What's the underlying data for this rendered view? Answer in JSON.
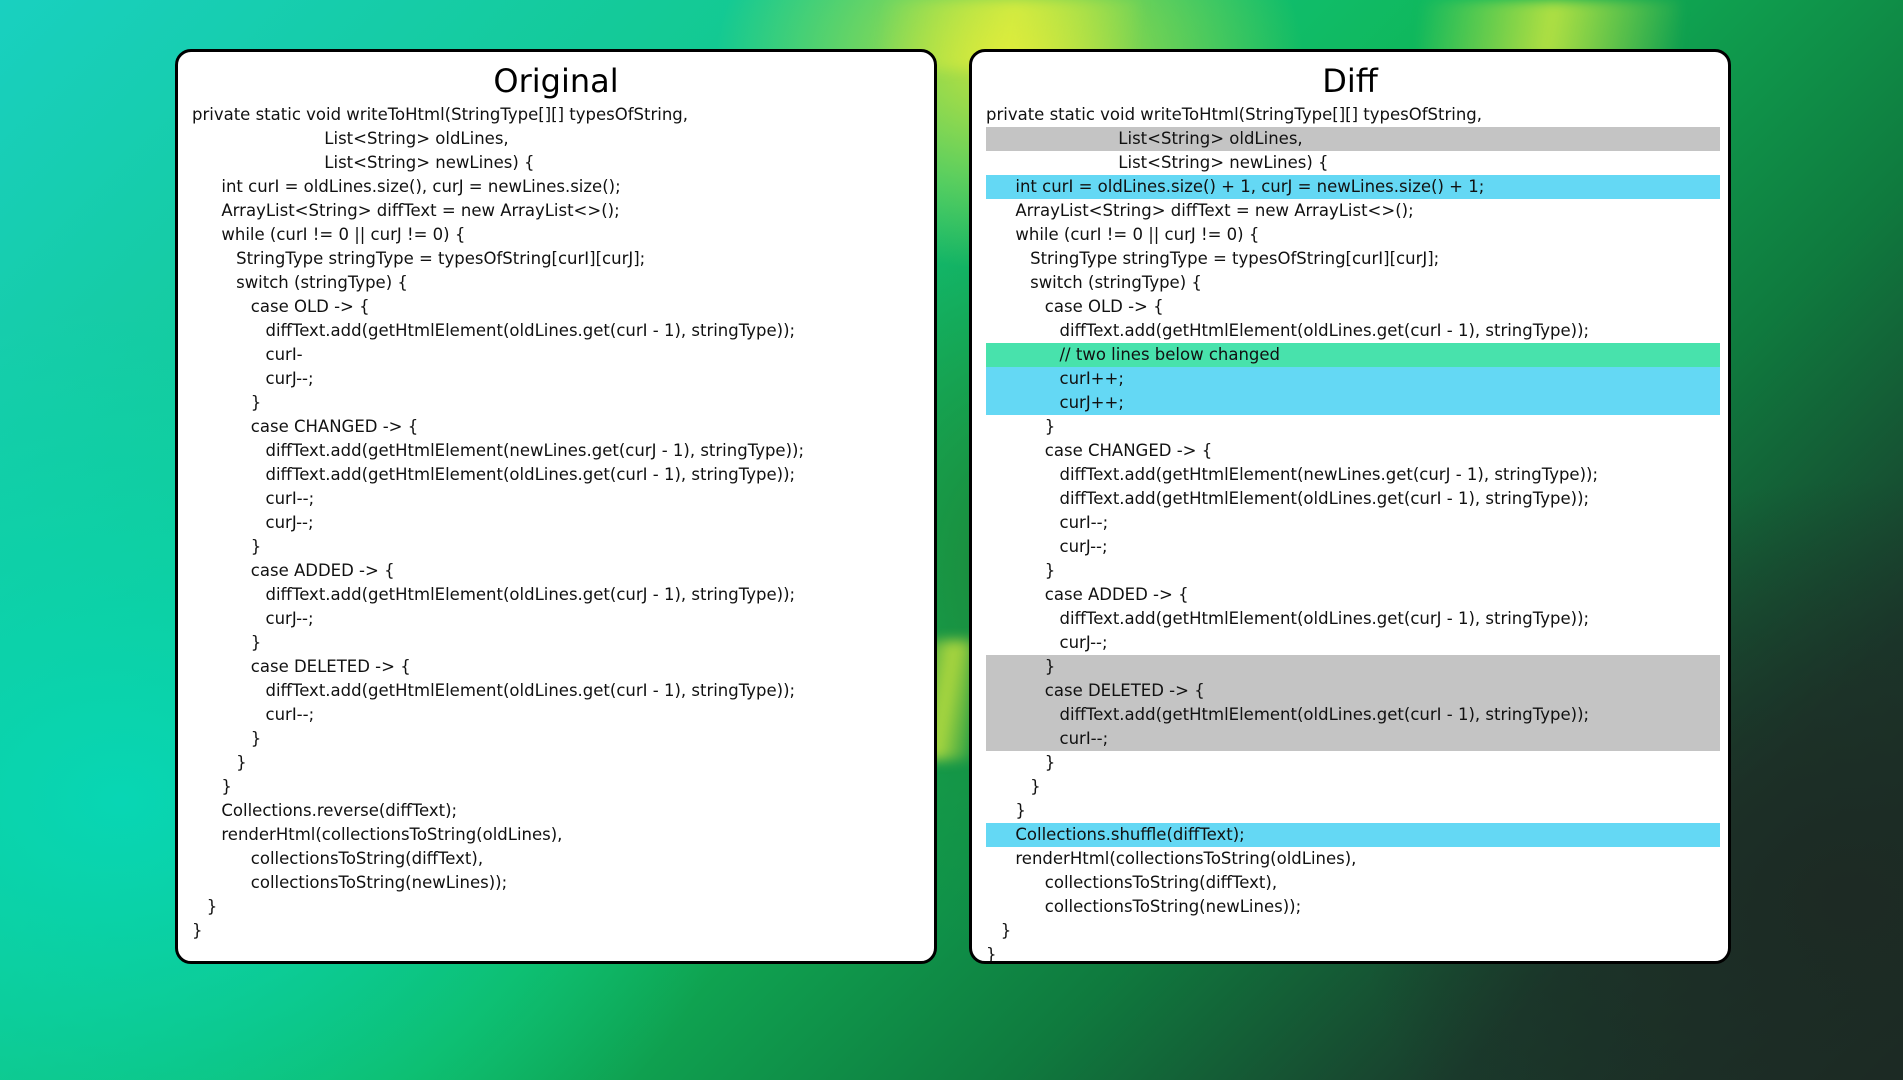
{
  "colors": {
    "gray": "#c4c4c4",
    "blue": "#64d8f4",
    "green": "#48e2ac"
  },
  "original": {
    "title": "Original",
    "lines": [
      {
        "indent": 0,
        "text": "private static void writeToHtml(StringType[][] typesOfString,"
      },
      {
        "indent": 9,
        "text": "List<String> oldLines,"
      },
      {
        "indent": 9,
        "text": "List<String> newLines) {"
      },
      {
        "indent": 2,
        "text": "int curI = oldLines.size(), curJ = newLines.size();"
      },
      {
        "indent": 2,
        "text": "ArrayList<String> diffText = new ArrayList<>();"
      },
      {
        "indent": 2,
        "text": "while (curI != 0 || curJ != 0) {"
      },
      {
        "indent": 3,
        "text": "StringType stringType = typesOfString[curI][curJ];"
      },
      {
        "indent": 3,
        "text": "switch (stringType) {"
      },
      {
        "indent": 4,
        "text": "case OLD -> {"
      },
      {
        "indent": 5,
        "text": "diffText.add(getHtmlElement(oldLines.get(curI - 1), stringType));"
      },
      {
        "indent": 5,
        "text": "curI-"
      },
      {
        "indent": 5,
        "text": "curJ--;"
      },
      {
        "indent": 4,
        "text": "}"
      },
      {
        "indent": 4,
        "text": "case CHANGED -> {"
      },
      {
        "indent": 5,
        "text": "diffText.add(getHtmlElement(newLines.get(curJ - 1), stringType));"
      },
      {
        "indent": 5,
        "text": "diffText.add(getHtmlElement(oldLines.get(curI - 1), stringType));"
      },
      {
        "indent": 5,
        "text": "curI--;"
      },
      {
        "indent": 5,
        "text": "curJ--;"
      },
      {
        "indent": 4,
        "text": "}"
      },
      {
        "indent": 4,
        "text": "case ADDED -> {"
      },
      {
        "indent": 5,
        "text": "diffText.add(getHtmlElement(oldLines.get(curJ - 1), stringType));"
      },
      {
        "indent": 5,
        "text": "curJ--;"
      },
      {
        "indent": 4,
        "text": "}"
      },
      {
        "indent": 4,
        "text": "case DELETED -> {"
      },
      {
        "indent": 5,
        "text": "diffText.add(getHtmlElement(oldLines.get(curI - 1), stringType));"
      },
      {
        "indent": 5,
        "text": "curI--;"
      },
      {
        "indent": 4,
        "text": "}"
      },
      {
        "indent": 3,
        "text": "}"
      },
      {
        "indent": 2,
        "text": "}"
      },
      {
        "indent": 2,
        "text": "Collections.reverse(diffText);"
      },
      {
        "indent": 2,
        "text": "renderHtml(collectionsToString(oldLines),"
      },
      {
        "indent": 4,
        "text": "collectionsToString(diffText),"
      },
      {
        "indent": 4,
        "text": "collectionsToString(newLines));"
      },
      {
        "indent": 1,
        "text": "}"
      },
      {
        "indent": 0,
        "text": "}"
      }
    ]
  },
  "diff": {
    "title": "Diff",
    "lines": [
      {
        "indent": 0,
        "text": "private static void writeToHtml(StringType[][] typesOfString,",
        "hl": ""
      },
      {
        "indent": 9,
        "text": "List<String> oldLines,",
        "hl": "gray"
      },
      {
        "indent": 9,
        "text": "List<String> newLines) {",
        "hl": ""
      },
      {
        "indent": 2,
        "text": "int curI = oldLines.size() + 1, curJ = newLines.size() + 1;",
        "hl": "blue"
      },
      {
        "indent": 2,
        "text": "ArrayList<String> diffText = new ArrayList<>();",
        "hl": ""
      },
      {
        "indent": 2,
        "text": "while (curI != 0 || curJ != 0) {",
        "hl": ""
      },
      {
        "indent": 3,
        "text": "StringType stringType = typesOfString[curI][curJ];",
        "hl": ""
      },
      {
        "indent": 3,
        "text": "switch (stringType) {",
        "hl": ""
      },
      {
        "indent": 4,
        "text": "case OLD -> {",
        "hl": ""
      },
      {
        "indent": 5,
        "text": "diffText.add(getHtmlElement(oldLines.get(curI - 1), stringType));",
        "hl": ""
      },
      {
        "indent": 5,
        "text": "// two lines below changed",
        "hl": "green"
      },
      {
        "indent": 5,
        "text": "curI++;",
        "hl": "blue"
      },
      {
        "indent": 5,
        "text": "curJ++;",
        "hl": "blue"
      },
      {
        "indent": 4,
        "text": "}",
        "hl": ""
      },
      {
        "indent": 4,
        "text": "case CHANGED -> {",
        "hl": ""
      },
      {
        "indent": 5,
        "text": "diffText.add(getHtmlElement(newLines.get(curJ - 1), stringType));",
        "hl": ""
      },
      {
        "indent": 5,
        "text": "diffText.add(getHtmlElement(oldLines.get(curI - 1), stringType));",
        "hl": ""
      },
      {
        "indent": 5,
        "text": "curI--;",
        "hl": ""
      },
      {
        "indent": 5,
        "text": "curJ--;",
        "hl": ""
      },
      {
        "indent": 4,
        "text": "}",
        "hl": ""
      },
      {
        "indent": 4,
        "text": "case ADDED -> {",
        "hl": ""
      },
      {
        "indent": 5,
        "text": "diffText.add(getHtmlElement(oldLines.get(curJ - 1), stringType));",
        "hl": ""
      },
      {
        "indent": 5,
        "text": "curJ--;",
        "hl": ""
      },
      {
        "indent": 4,
        "text": "}",
        "hl": "gray"
      },
      {
        "indent": 4,
        "text": "case DELETED -> {",
        "hl": "gray"
      },
      {
        "indent": 5,
        "text": "diffText.add(getHtmlElement(oldLines.get(curI - 1), stringType));",
        "hl": "gray"
      },
      {
        "indent": 5,
        "text": "curI--;",
        "hl": "gray"
      },
      {
        "indent": 4,
        "text": "}",
        "hl": ""
      },
      {
        "indent": 3,
        "text": "}",
        "hl": ""
      },
      {
        "indent": 2,
        "text": "}",
        "hl": ""
      },
      {
        "indent": 2,
        "text": "Collections.shuffle(diffText);",
        "hl": "blue"
      },
      {
        "indent": 2,
        "text": "renderHtml(collectionsToString(oldLines),",
        "hl": ""
      },
      {
        "indent": 4,
        "text": "collectionsToString(diffText),",
        "hl": ""
      },
      {
        "indent": 4,
        "text": "collectionsToString(newLines));",
        "hl": ""
      },
      {
        "indent": 1,
        "text": "}",
        "hl": ""
      },
      {
        "indent": 0,
        "text": "}",
        "hl": ""
      }
    ]
  }
}
